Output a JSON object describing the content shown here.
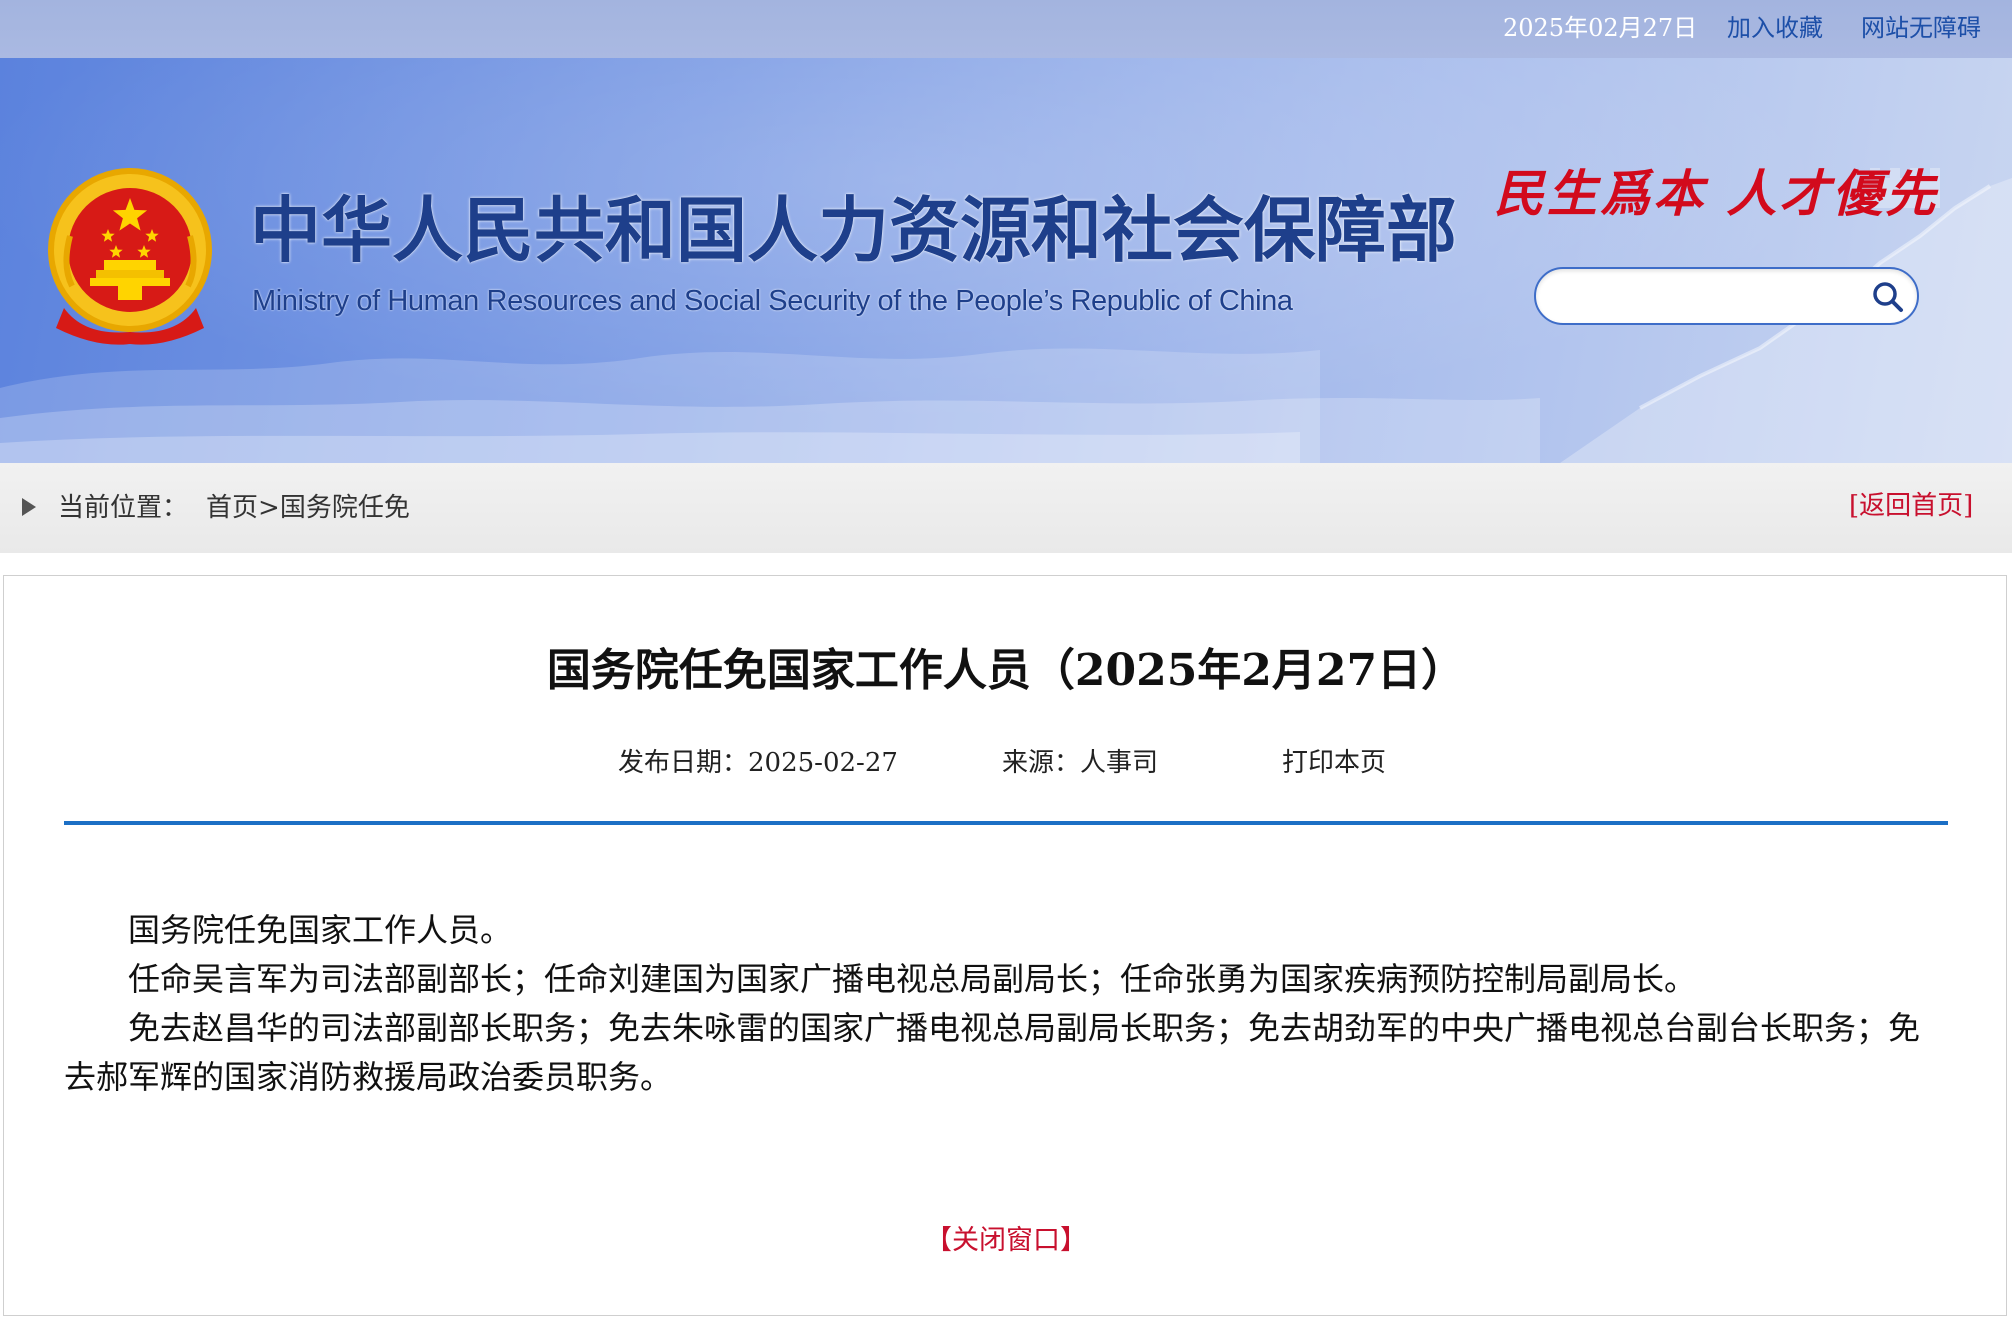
{
  "topbar": {
    "date": "2025年02月27日",
    "links": [
      {
        "label": "加入收藏"
      },
      {
        "label": "网站无障碍"
      }
    ]
  },
  "header": {
    "title_cn": "中华人民共和国人力资源和社会保障部",
    "title_en": "Ministry of Human Resources and Social Security of the People’s Republic of China",
    "slogan": "民生爲本 人才優先",
    "search": {
      "value": "",
      "placeholder": ""
    },
    "icons": {
      "emblem": "national-emblem-icon",
      "search": "search-icon"
    }
  },
  "breadcrumb": {
    "label": "当前位置：",
    "home": "首页",
    "separator": ">",
    "current": "国务院任免",
    "back": "[返回首页]",
    "icon": "triangle-right-icon"
  },
  "article": {
    "title": "国务院任免国家工作人员（2025年2月27日）",
    "meta": {
      "date": "发布日期：2025-02-27",
      "source": "来源：人事司",
      "print": "打印本页"
    },
    "paragraphs": [
      "国务院任免国家工作人员。",
      "任命吴言军为司法部副部长；任命刘建国为国家广播电视总局副局长；任命张勇为国家疾病预防控制局副局长。",
      "免去赵昌华的司法部副部长职务；免去朱咏雷的国家广播电视总局副局长职务；免去胡劲军的中央广播电视总台副台长职务；免去郝军辉的国家消防救援局政治委员职务。"
    ],
    "close": "【关闭窗口】"
  },
  "colors": {
    "brand_blue": "#1e3f8b",
    "rule_blue": "#1c6fc5",
    "link_red": "#c8102e",
    "slogan_red": "#d20a1c",
    "topbar_link": "#1d4fa8"
  }
}
